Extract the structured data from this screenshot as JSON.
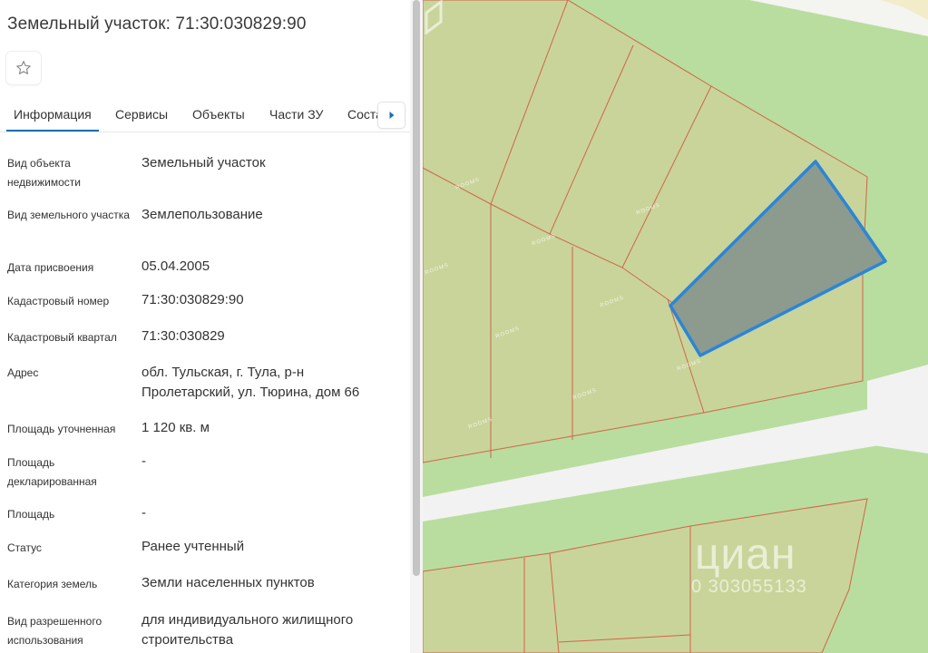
{
  "header": {
    "title": "Земельный участок: 71:30:030829:90",
    "favorite_icon": "star-outline-icon"
  },
  "tabs": [
    {
      "label": "Информация",
      "active": true
    },
    {
      "label": "Сервисы",
      "active": false
    },
    {
      "label": "Объекты",
      "active": false
    },
    {
      "label": "Части ЗУ",
      "active": false
    },
    {
      "label": "Соста",
      "active": false
    }
  ],
  "tabs_next_icon": "chevron-right-icon",
  "info": {
    "object_type": {
      "label": "Вид объекта недвижимости",
      "value": "Земельный участок"
    },
    "plot_type": {
      "label": "Вид земельного участка",
      "value": "Землепользование"
    },
    "assigned_date": {
      "label": "Дата присвоения",
      "value": "05.04.2005"
    },
    "cadastral_number": {
      "label": "Кадастровый номер",
      "value": "71:30:030829:90"
    },
    "cadastral_block": {
      "label": "Кадастровый квартал",
      "value": "71:30:030829"
    },
    "address": {
      "label": "Адрес",
      "value": "обл. Тульская, г. Тула, р-н Пролетарский, ул. Тюрина, дом 66"
    },
    "area_refined": {
      "label": "Площадь уточненная",
      "value": "1 120 кв. м"
    },
    "area_declared": {
      "label": "Площадь декларированная",
      "value": "-"
    },
    "area": {
      "label": "Площадь",
      "value": "-"
    },
    "status": {
      "label": "Статус",
      "value": "Ранее учтенный"
    },
    "land_category": {
      "label": "Категория земель",
      "value": "Земли населенных пунктов"
    },
    "permitted_use": {
      "label": "Вид разрешенного использования",
      "value": "для индивидуального жилищного строительства"
    }
  },
  "map": {
    "watermark": "ROOMS",
    "cian_brand": "циан",
    "cian_id": "0 303055133",
    "colors": {
      "background": "#b9dd9e",
      "parcel": "#c9d49a",
      "parcel_border": "#d0654a",
      "selected_fill": "#8d9a8e",
      "selected_border": "#2a86d8",
      "road": "#f2f2f2"
    }
  }
}
